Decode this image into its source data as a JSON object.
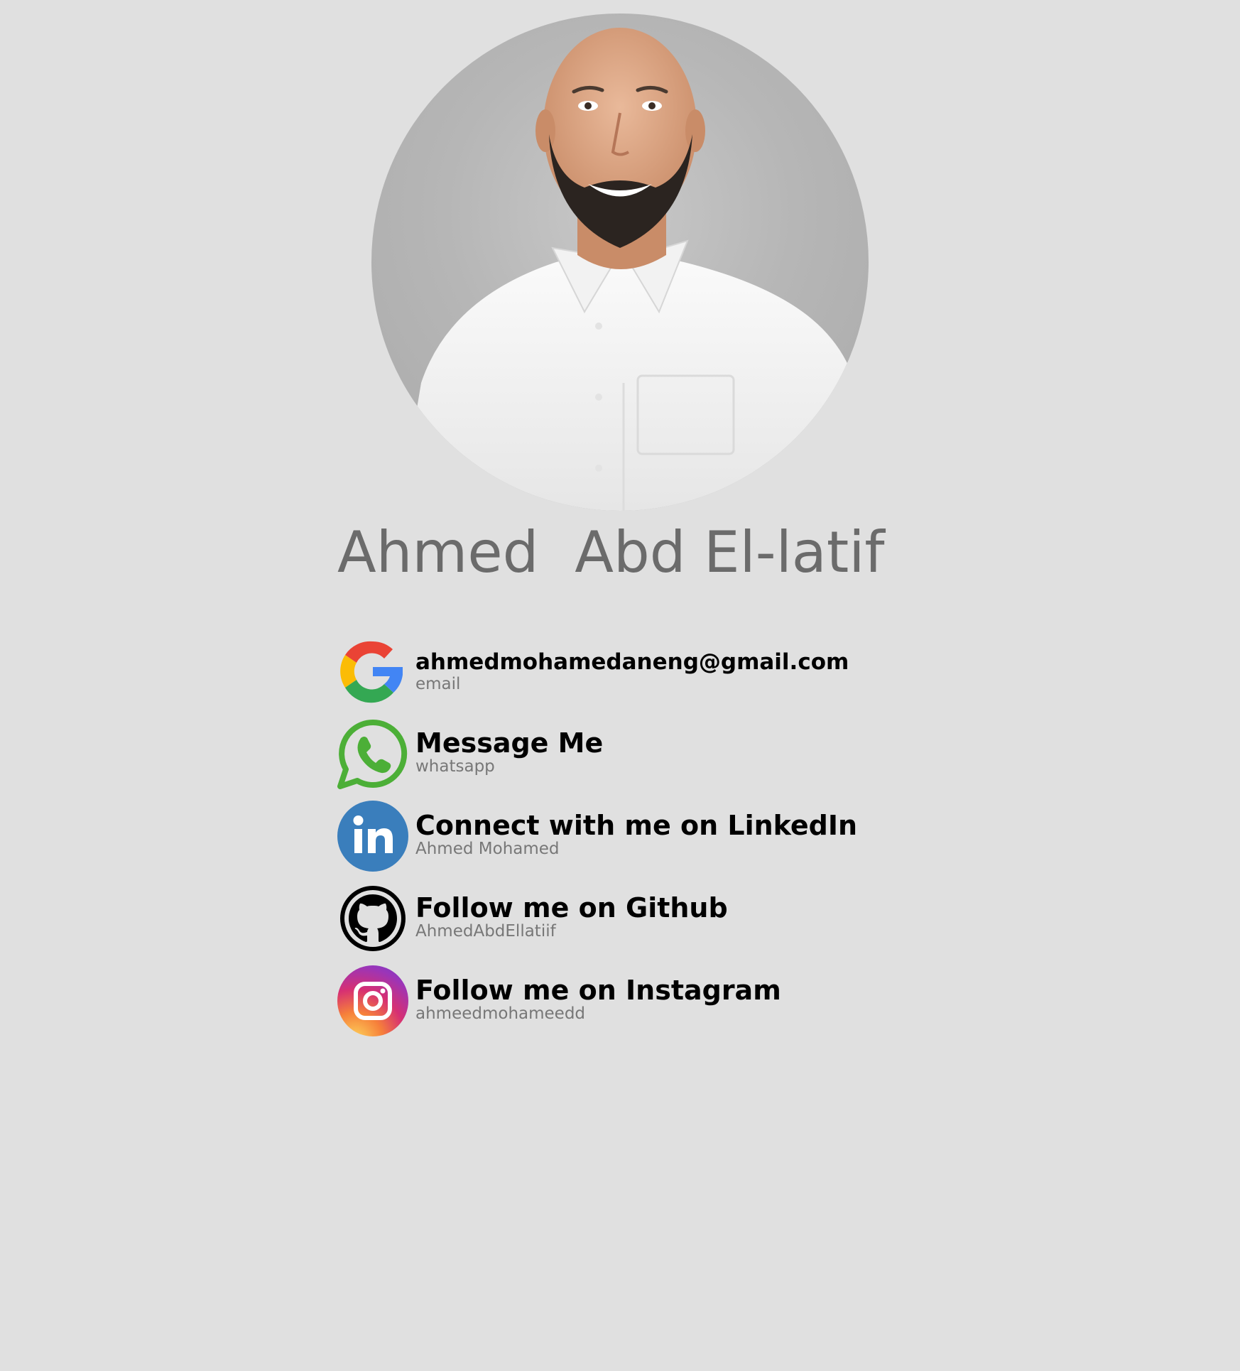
{
  "profile": {
    "photo_alt": "profile-photo",
    "name": "Ahmed  Abd El-latif"
  },
  "links": [
    {
      "icon": "google-icon",
      "title": "ahmedmohamedaneng@gmail.com",
      "subtitle": "email"
    },
    {
      "icon": "whatsapp-icon",
      "title": "Message Me",
      "subtitle": "whatsapp"
    },
    {
      "icon": "linkedin-icon",
      "title": "Connect with me on LinkedIn",
      "subtitle": "Ahmed Mohamed"
    },
    {
      "icon": "github-icon",
      "title": "Follow me on Github",
      "subtitle": "AhmedAbdEllatiif"
    },
    {
      "icon": "instagram-icon",
      "title": "Follow me on Instagram",
      "subtitle": "ahmeedmohameedd"
    }
  ],
  "colors": {
    "background": "#e0e0e0",
    "name": "#6b6b6b",
    "title": "#000000",
    "subtitle": "#777777",
    "whatsapp": "#4caf37",
    "linkedin": "#3a7ebc"
  }
}
